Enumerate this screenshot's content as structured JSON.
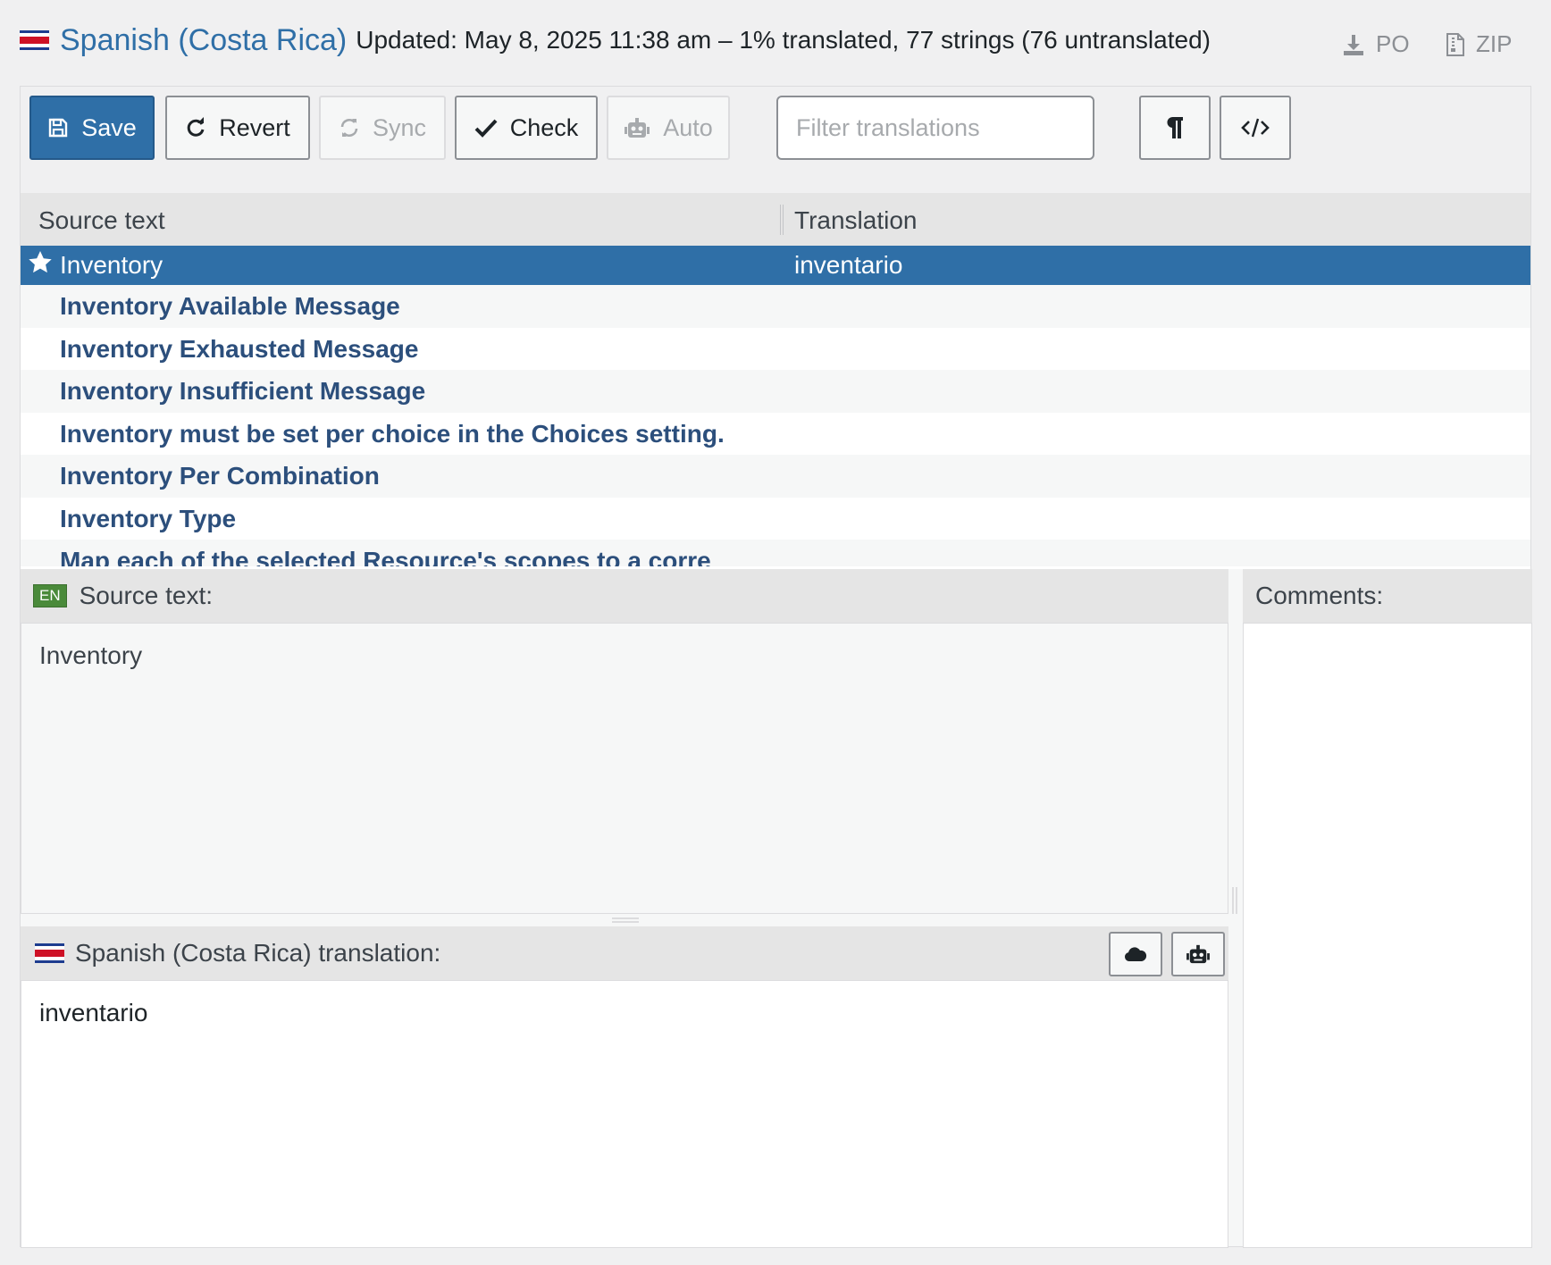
{
  "header": {
    "language_title": "Spanish (Costa Rica)",
    "meta": "Updated: May 8, 2025 11:38 am – 1% translated, 77 strings (76 untranslated)",
    "download_po": "PO",
    "download_zip": "ZIP"
  },
  "toolbar": {
    "save": "Save",
    "revert": "Revert",
    "sync": "Sync",
    "check": "Check",
    "auto": "Auto",
    "filter_placeholder": "Filter translations"
  },
  "list": {
    "col_source": "Source text",
    "col_translation": "Translation",
    "rows": [
      {
        "source": "Inventory",
        "translation": "inventario"
      },
      {
        "source": "Inventory Available Message",
        "translation": ""
      },
      {
        "source": "Inventory Exhausted Message",
        "translation": ""
      },
      {
        "source": "Inventory Insufficient Message",
        "translation": ""
      },
      {
        "source": "Inventory must be set per choice in the Choices setting.",
        "translation": ""
      },
      {
        "source": "Inventory Per Combination",
        "translation": ""
      },
      {
        "source": "Inventory Type",
        "translation": ""
      },
      {
        "source": "Map each of the selected Resource's scopes to a corre",
        "translation": ""
      }
    ]
  },
  "source_pane": {
    "lang_badge": "EN",
    "label": "Source text:",
    "text": "Inventory"
  },
  "translation_pane": {
    "label": "Spanish (Costa Rica) translation:",
    "text": "inventario"
  },
  "comments": {
    "label": "Comments:"
  },
  "colors": {
    "accent": "#2f6fa7",
    "link_text": "#2c4f7c",
    "en_badge": "#4a8a3a"
  },
  "icons": [
    "download-icon",
    "zip-file-icon",
    "save-icon",
    "revert-icon",
    "sync-icon",
    "check-icon",
    "robot-icon",
    "pilcrow-icon",
    "code-icon",
    "star-icon",
    "cloud-icon"
  ]
}
